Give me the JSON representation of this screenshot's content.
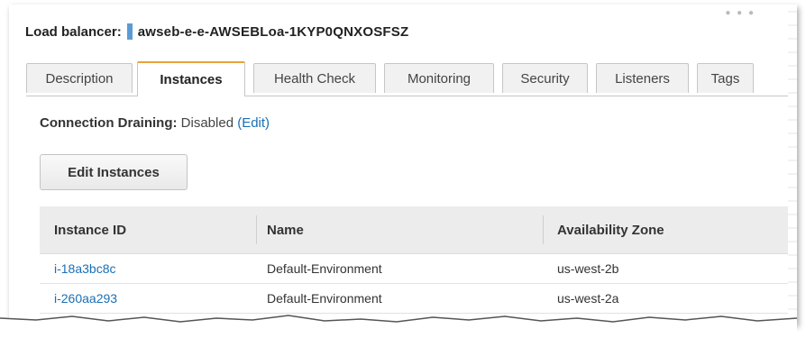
{
  "header": {
    "label": "Load balancer:",
    "name": "awseb-e-e-AWSEBLoa-1KYP0QNXOSFSZ"
  },
  "tabs": [
    {
      "label": "Description",
      "active": false
    },
    {
      "label": "Instances",
      "active": true
    },
    {
      "label": "Health Check",
      "active": false
    },
    {
      "label": "Monitoring",
      "active": false
    },
    {
      "label": "Security",
      "active": false
    },
    {
      "label": "Listeners",
      "active": false
    },
    {
      "label": "Tags",
      "active": false
    }
  ],
  "connection_draining": {
    "label": "Connection Draining:",
    "value": "Disabled",
    "edit_link": "(Edit)"
  },
  "edit_instances_button": "Edit Instances",
  "table": {
    "columns": [
      "Instance ID",
      "Name",
      "Availability Zone"
    ],
    "rows": [
      [
        "i-18a3bc8c",
        "Default-Environment",
        "us-west-2b"
      ],
      [
        "i-260aa293",
        "Default-Environment",
        "us-west-2a"
      ]
    ]
  },
  "colors": {
    "accent_tab": "#e8a13a",
    "link": "#1a6fb5",
    "marker": "#5b9bd5"
  }
}
